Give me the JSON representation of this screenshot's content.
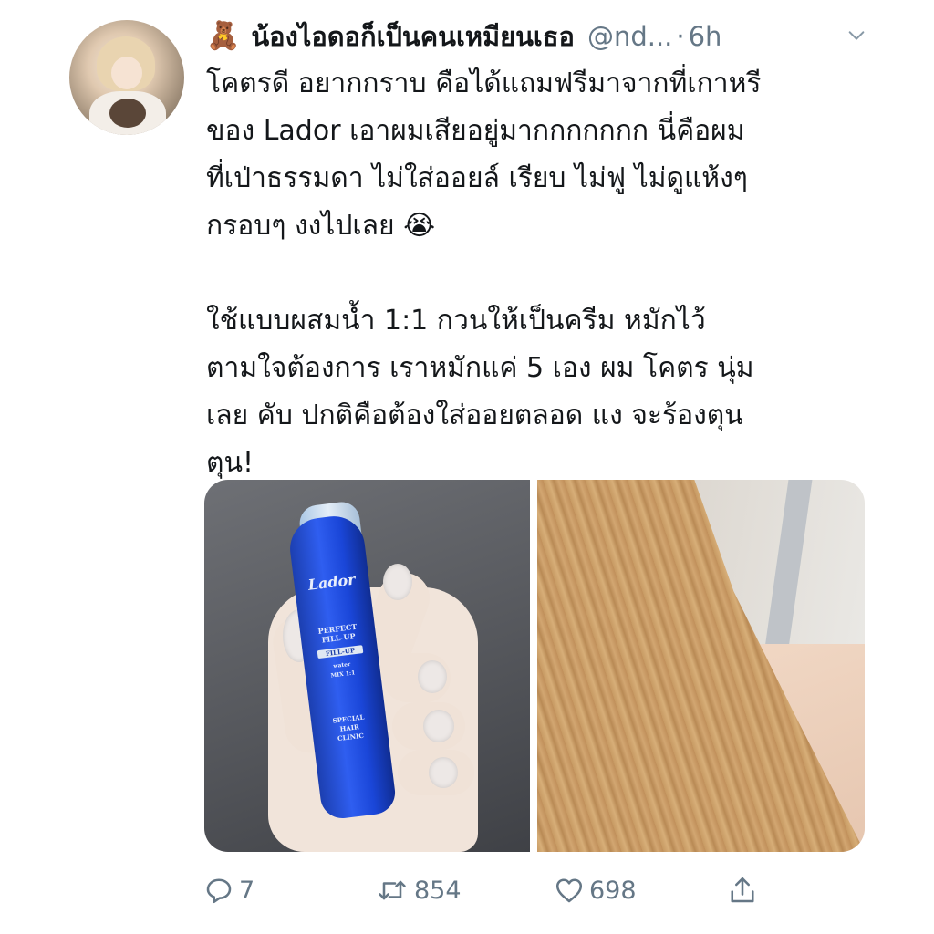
{
  "tweet": {
    "display_name": "น้องไอดอก็เป็นคนเหมียนเธอ",
    "name_emoji": "🧸",
    "handle": "@nd...",
    "separator": "·",
    "time": "6h",
    "text_lines_p1": [
      "โคตรดี อยากกราบ คือได้แถมฟรีมาจากที่เกาหรี",
      "ของ Lador เอาผมเสียอยู่มากกกกกกก นี่คือผม",
      "ที่เป่าธรรมดา ไม่ใส่ออยล์ เรียบ ไม่ฟู ไม่ดูแห้งๆ",
      "กรอบๆ งงไปเลย 😭"
    ],
    "text_lines_p2": [
      "ใช้แบบผสมน้ำ 1:1 กวนให้เป็นครีม หมักไว้",
      "ตามใจต้องการ เราหมักแค่ 5 เอง ผม โคตร นุ่ม",
      "เลย คับ ปกติคือต้องใส่ออยตลอด แง จะร้องตุน",
      "ตุน!"
    ]
  },
  "media": {
    "left_photo": {
      "brand": "Lador",
      "label_lines": [
        "PERFECT",
        "FILL-UP",
        "FILL-UP",
        "water",
        "MIX 1:1",
        "SPECIAL",
        "HAIR",
        "CLINIC"
      ]
    },
    "right_photo": {}
  },
  "actions": {
    "reply_count": "7",
    "retweet_count": "854",
    "like_count": "698"
  },
  "icons": {
    "reply": "reply-icon",
    "retweet": "retweet-icon",
    "like": "heart-icon",
    "share": "share-icon",
    "menu": "chevron-down-icon"
  },
  "colors": {
    "text": "#14171a",
    "secondary": "#657786",
    "vial_blue": "#1f4fe0"
  }
}
